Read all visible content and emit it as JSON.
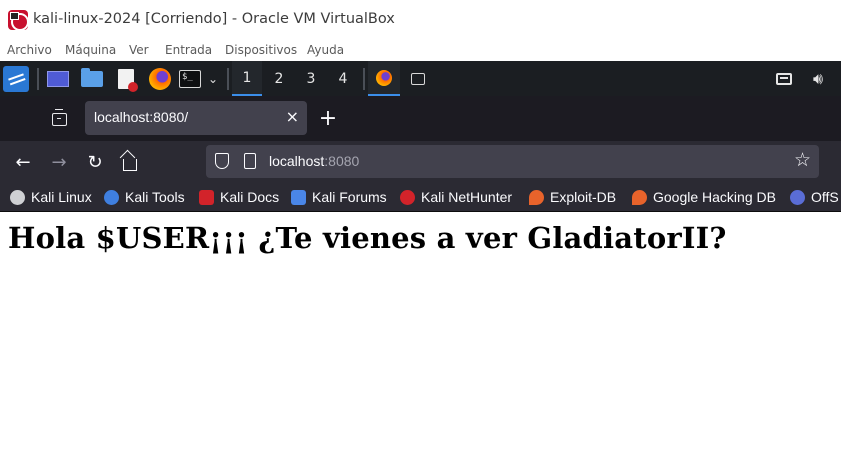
{
  "window": {
    "title": "kali-linux-2024 [Corriendo] - Oracle VM VirtualBox"
  },
  "vbox_menu": [
    "Archivo",
    "Máquina",
    "Ver",
    "Entrada",
    "Dispositivos",
    "Ayuda"
  ],
  "kali_panel": {
    "launchers": [
      "kali-menu-icon",
      "show-desktop-icon",
      "file-manager-icon",
      "text-editor-icon",
      "firefox-icon",
      "terminal-icon"
    ],
    "workspaces": [
      "1",
      "2",
      "3",
      "4"
    ],
    "active_workspace": "1",
    "accent_color": "#3b8eea"
  },
  "browser": {
    "tab": {
      "title": "localhost:8080/",
      "close": "×"
    },
    "new_tab": "+",
    "url": {
      "host": "localhost",
      "port": ":8080"
    },
    "bookmarks": [
      {
        "label": "Kali Linux",
        "icon": "kali-dragon-icon",
        "color": "#cfd0d4"
      },
      {
        "label": "Kali Tools",
        "icon": "kali-tools-icon",
        "color": "#3f7fe0"
      },
      {
        "label": "Kali Docs",
        "icon": "kali-docs-icon",
        "color": "#d2232a"
      },
      {
        "label": "Kali Forums",
        "icon": "kali-forums-icon",
        "color": "#4a86e8"
      },
      {
        "label": "Kali NetHunter",
        "icon": "nethunter-icon",
        "color": "#d2232a"
      },
      {
        "label": "Exploit-DB",
        "icon": "exploit-db-icon",
        "color": "#e8632b"
      },
      {
        "label": "Google Hacking DB",
        "icon": "ghdb-icon",
        "color": "#e8632b"
      },
      {
        "label": "OffS",
        "icon": "offsec-icon",
        "color": "#5a6dd6"
      }
    ]
  },
  "page": {
    "heading": "Hola $USER¡¡¡ ¿Te vienes a ver GladiatorII?"
  }
}
